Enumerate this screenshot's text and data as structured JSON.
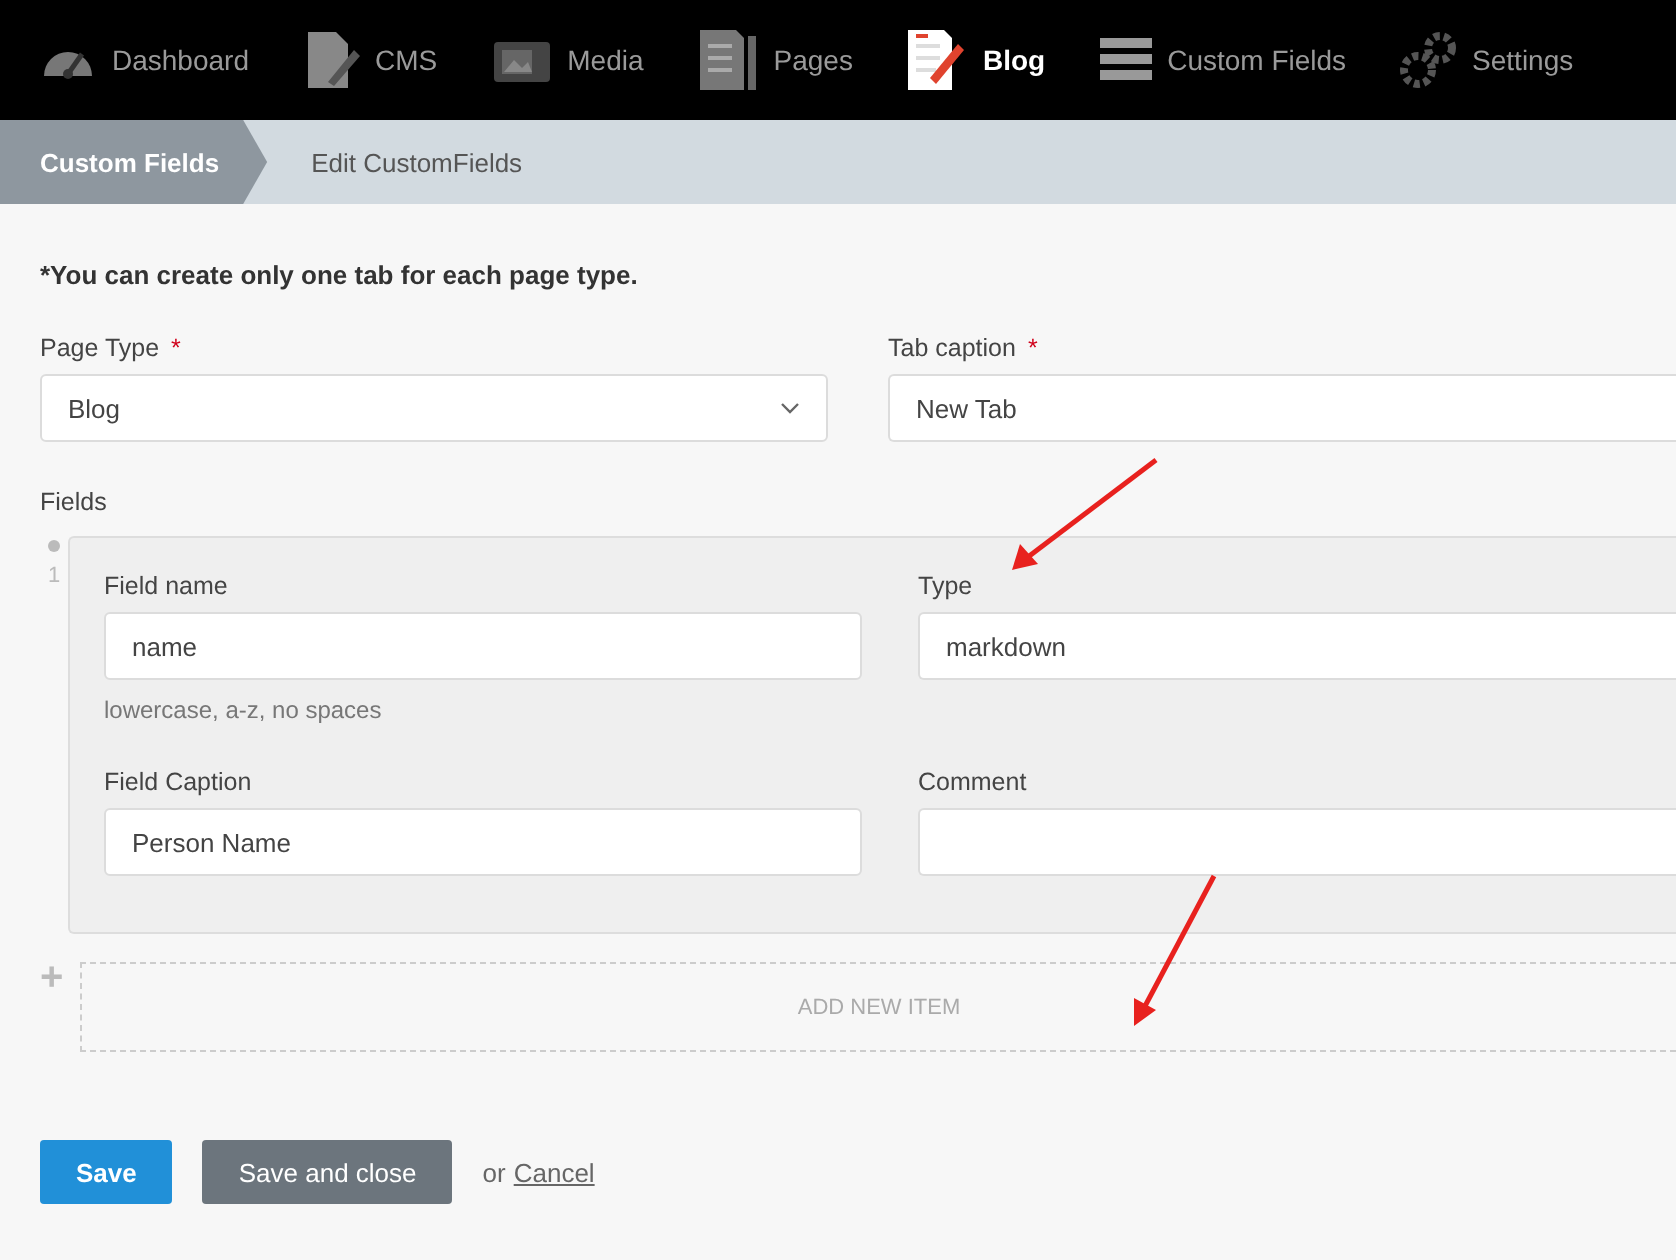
{
  "nav": [
    {
      "label": "Dashboard",
      "selected": false
    },
    {
      "label": "CMS",
      "selected": false
    },
    {
      "label": "Media",
      "selected": false
    },
    {
      "label": "Pages",
      "selected": false
    },
    {
      "label": "Blog",
      "selected": true
    },
    {
      "label": "Custom Fields",
      "selected": false
    },
    {
      "label": "Settings",
      "selected": false
    }
  ],
  "breadcrumb": [
    {
      "label": "Custom Fields",
      "selected": true
    },
    {
      "label": "Edit CustomFields",
      "selected": false
    }
  ],
  "note": "*You can create only one tab for each page type.",
  "page_type": {
    "label": "Page Type",
    "required_mark": "*",
    "value": "Blog"
  },
  "tab_caption": {
    "label": "Tab caption",
    "required_mark": "*",
    "value": "New Tab"
  },
  "fields_label": "Fields",
  "items": [
    {
      "number": "1",
      "field_name": {
        "label": "Field name",
        "value": "name",
        "hint": "lowercase, a-z, no spaces"
      },
      "type": {
        "label": "Type",
        "value": "markdown"
      },
      "field_caption": {
        "label": "Field Caption",
        "value": "Person Name"
      },
      "comment": {
        "label": "Comment"
      }
    }
  ],
  "add_item": {
    "icon": "+",
    "label": "ADD NEW ITEM"
  },
  "buttons": {
    "save": "Save",
    "save_close": "Save and close",
    "or": "or",
    "cancel": "Cancel"
  }
}
